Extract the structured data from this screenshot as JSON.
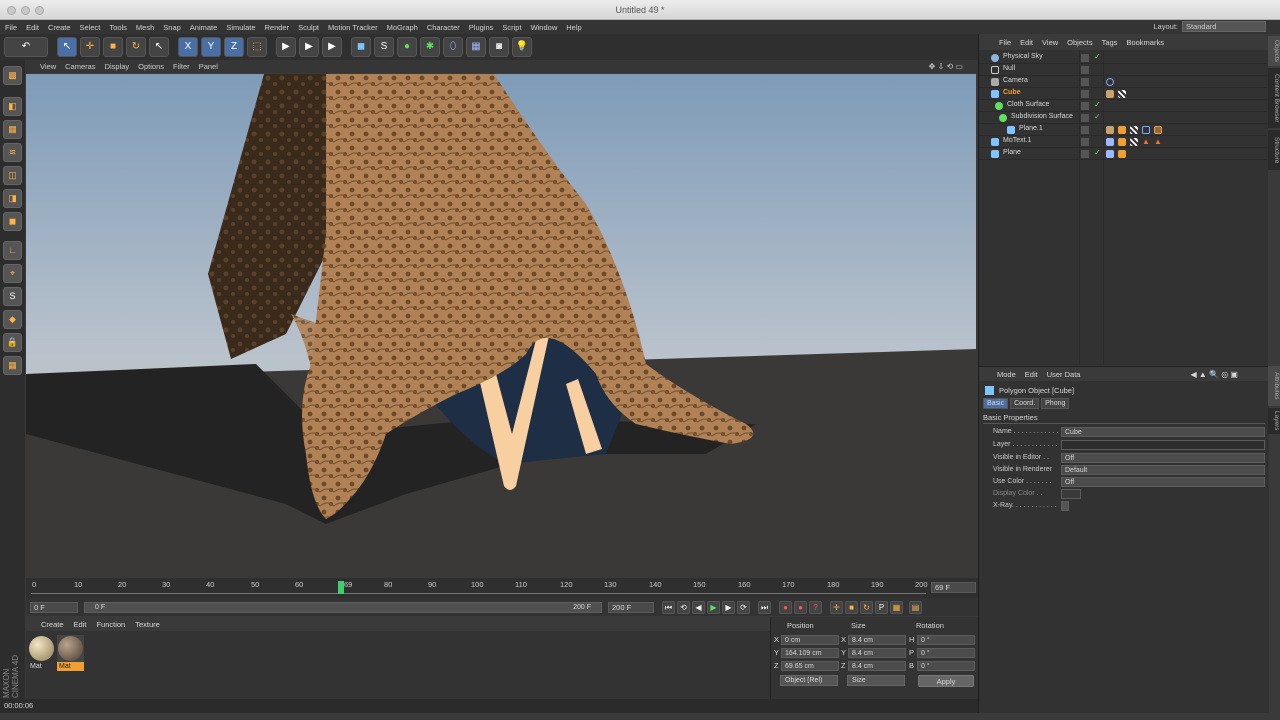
{
  "window": {
    "title": "Untitled 49 *"
  },
  "menubar": [
    "File",
    "Edit",
    "Create",
    "Select",
    "Tools",
    "Mesh",
    "Snap",
    "Animate",
    "Simulate",
    "Render",
    "Sculpt",
    "Motion Tracker",
    "MoGraph",
    "Character",
    "Plugins",
    "Script",
    "Window",
    "Help"
  ],
  "layout": {
    "label": "Layout:",
    "value": "Standard"
  },
  "viewport": {
    "menu": [
      "View",
      "Cameras",
      "Display",
      "Options",
      "Filter",
      "Panel"
    ]
  },
  "timeline": {
    "ticks": [
      "0",
      "10",
      "20",
      "30",
      "40",
      "50",
      "60",
      "69",
      "80",
      "90",
      "100",
      "110",
      "120",
      "130",
      "140",
      "150",
      "160",
      "170",
      "180",
      "190",
      "200"
    ],
    "current": "69 F"
  },
  "transport": {
    "start": "0 F",
    "range_start": "0 F",
    "range_end": "200 F",
    "end": "200 F"
  },
  "materials": {
    "menu": [
      "Create",
      "Edit",
      "Function",
      "Texture"
    ],
    "items": [
      {
        "label": "Mat"
      },
      {
        "label": "Mat"
      }
    ]
  },
  "coordinates": {
    "headers": [
      "Position",
      "Size",
      "Rotation"
    ],
    "rows": [
      {
        "axis": "X",
        "pos": "0 cm",
        "saxis": "X",
        "size": "8.4 cm",
        "raxis": "H",
        "rot": "0 °"
      },
      {
        "axis": "Y",
        "pos": "164.109 cm",
        "saxis": "Y",
        "size": "8.4 cm",
        "raxis": "P",
        "rot": "0 °"
      },
      {
        "axis": "Z",
        "pos": "69.65 cm",
        "saxis": "Z",
        "size": "8.4 cm",
        "raxis": "B",
        "rot": "0 °"
      }
    ],
    "mode": "Object (Rel)",
    "size_mode": "Size",
    "apply": "Apply"
  },
  "status": {
    "time": "00:00:06"
  },
  "brand": "MAXON CINEMA 4D",
  "objects": {
    "menu": [
      "File",
      "Edit",
      "View",
      "Objects",
      "Tags",
      "Bookmarks"
    ],
    "items": [
      {
        "name": "Physical Sky"
      },
      {
        "name": "Null"
      },
      {
        "name": "Camera"
      },
      {
        "name": "Cube"
      },
      {
        "name": "Cloth Surface"
      },
      {
        "name": "Subdivision Surface"
      },
      {
        "name": "Plane.1"
      },
      {
        "name": "MoText.1"
      },
      {
        "name": "Plane"
      }
    ]
  },
  "attributes": {
    "menu": [
      "Mode",
      "Edit",
      "User Data"
    ],
    "title": "Polygon Object [Cube]",
    "tabs": [
      "Basic",
      "Coord.",
      "Phong"
    ],
    "section": "Basic Properties",
    "rows": [
      {
        "label": "Name . . . . . . . . . . . .",
        "value": "Cube"
      },
      {
        "label": "Layer . . . . . . . . . . . .",
        "value": ""
      },
      {
        "label": "Visible in Editor . .",
        "value": "Off"
      },
      {
        "label": "Visible in Renderer",
        "value": "Default"
      },
      {
        "label": "Use Color . . . . . . .",
        "value": "Off"
      },
      {
        "label": "Display Color . .",
        "value": ""
      },
      {
        "label": "X-Ray. . . . . . . . . . . .",
        "value": ""
      }
    ]
  },
  "side_tabs": [
    "Objects",
    "Content Browser",
    "Structure",
    "Attributes",
    "Layers"
  ]
}
